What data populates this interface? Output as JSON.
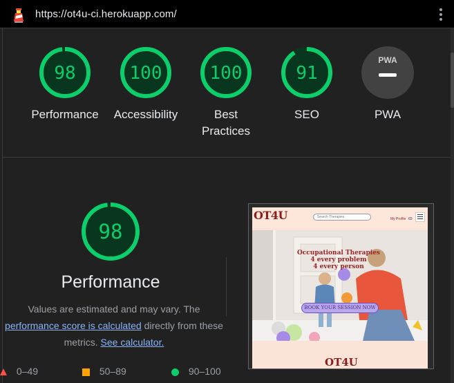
{
  "browser": {
    "url": "https://ot4u-ci.herokuapp.com/"
  },
  "summary": {
    "gauges": [
      {
        "score": "98",
        "label": "Performance",
        "value": 0.98
      },
      {
        "score": "100",
        "label": "Accessibility",
        "value": 1.0
      },
      {
        "score": "100",
        "label_line1": "Best",
        "label_line2": "Practices",
        "value": 1.0
      },
      {
        "score": "91",
        "label": "SEO",
        "value": 0.91
      },
      {
        "badge": "PWA",
        "label": "PWA"
      }
    ]
  },
  "performance": {
    "score": "98",
    "score_value": 0.98,
    "title": "Performance",
    "note_part1": "Values are estimated and may vary. The",
    "note_link1": "performance score is calculated",
    "note_part2": "directly from these",
    "note_part3": "metrics.",
    "note_link2": "See calculator.",
    "legend": [
      {
        "range": "0–49",
        "color": "#ff4e42"
      },
      {
        "range": "50–89",
        "color": "#ffa400"
      },
      {
        "range": "90–100",
        "color": "#0cce6b"
      }
    ]
  },
  "screenshot": {
    "logo": "OT4U",
    "search_placeholder": "Search Therapies",
    "profile": "My Profile",
    "cart": "€0",
    "hero_line1": "Occupational Therapies",
    "hero_line2": "4 every problem",
    "hero_line3": "4 every person",
    "cta": "BOOK YOUR SESSION NOW",
    "footer_logo": "OT4U"
  },
  "colors": {
    "pass": "#0cce6b",
    "pass_bg": "#08361e",
    "background": "#212121",
    "link": "#8ab4f8"
  }
}
